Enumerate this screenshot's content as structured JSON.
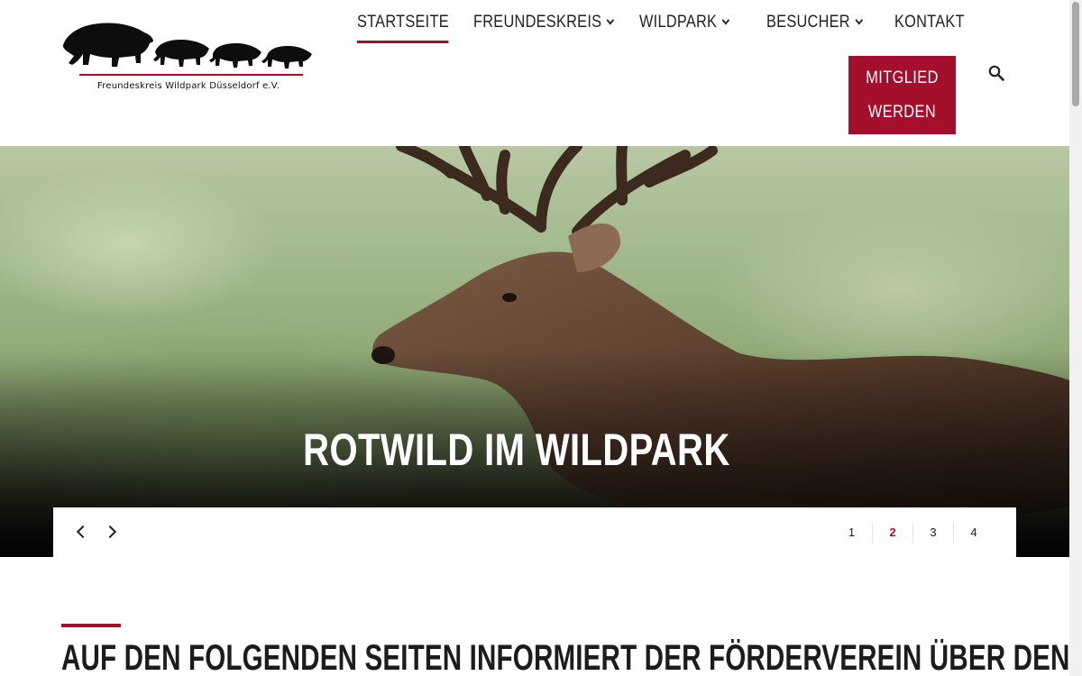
{
  "logo": {
    "text": "Freundeskreis Wildpark Düsseldorf e.V."
  },
  "nav": {
    "items": [
      {
        "label": "STARTSEITE",
        "active": true,
        "dropdown": false
      },
      {
        "label": "FREUNDESKREIS",
        "active": false,
        "dropdown": true
      },
      {
        "label": "WILDPARK",
        "active": false,
        "dropdown": true
      },
      {
        "label": "BESUCHER",
        "active": false,
        "dropdown": true
      },
      {
        "label": "KONTAKT",
        "active": false,
        "dropdown": false
      }
    ],
    "member_button": {
      "line1": "MITGLIED",
      "line2": "WERDEN"
    },
    "search_icon": "search-icon"
  },
  "hero": {
    "title": "ROTWILD IM WILDPARK",
    "slides": [
      "1",
      "2",
      "3",
      "4"
    ],
    "active_slide": "2"
  },
  "content": {
    "heading": "AUF DEN FOLGENDEN SEITEN INFORMIERT DER FÖRDERVEREIN ÜBER DEN"
  },
  "colors": {
    "accent": "#a30f2d"
  }
}
